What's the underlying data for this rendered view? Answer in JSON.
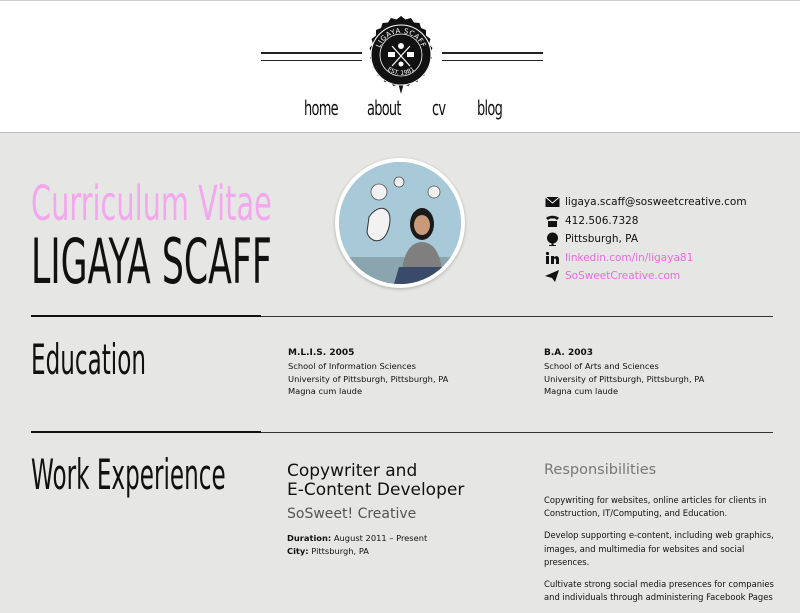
{
  "header": {
    "logo": {
      "text_top": "LIGAYA SCAFF",
      "text_bottom": "EST. 1981"
    },
    "nav": [
      {
        "label": "home"
      },
      {
        "label": "about"
      },
      {
        "label": "cv"
      },
      {
        "label": "blog"
      }
    ]
  },
  "intro": {
    "label": "Curriculum Vitae",
    "name": "LIGAYA SCAFF"
  },
  "contact": [
    {
      "icon": "mail-icon",
      "text": "ligaya.scaff@sosweetcreative.com",
      "link": false
    },
    {
      "icon": "phone-icon",
      "text": "412.506.7328",
      "link": false
    },
    {
      "icon": "globe-icon",
      "text": "Pittsburgh, PA",
      "link": false
    },
    {
      "icon": "linkedin-icon",
      "text": "linkedin.com/in/ligaya81",
      "link": true
    },
    {
      "icon": "paper-plane-icon",
      "text": "SoSweetCreative.com",
      "link": true
    }
  ],
  "education": {
    "title": "Education",
    "entries": [
      {
        "degree": "M.L.I.S. 2005",
        "school": "School of Information Sciences",
        "university": "University of Pittsburgh, Pittsburgh, PA",
        "honors": "Magna cum laude"
      },
      {
        "degree": "B.A. 2003",
        "school": "School of Arts and Sciences",
        "university": "University of Pittsburgh, Pittsburgh, PA",
        "honors": "Magna cum laude"
      }
    ]
  },
  "work": {
    "title": "Work Experience",
    "job": {
      "title_line1": "Copywriter and",
      "title_line2": "E-Content Developer",
      "company": "SoSweet! Creative",
      "duration_label": "Duration:",
      "duration": "August 2011 – Present",
      "city_label": "City:",
      "city": "Pittsburgh, PA"
    },
    "responsibilities_title": "Responsibilities",
    "responsibilities": [
      "Copywriting for websites, online articles for clients in Construction, IT/Computing, and Education.",
      "Develop supporting e-content, including web graphics, images, and multimedia for websites and social presences.",
      "Cultivate strong social media presences for companies and individuals through administering Facebook Pages"
    ]
  },
  "colors": {
    "accent_pink": "#f3a7ee",
    "link_pink": "#e86be0",
    "background": "#e6e6e4"
  }
}
